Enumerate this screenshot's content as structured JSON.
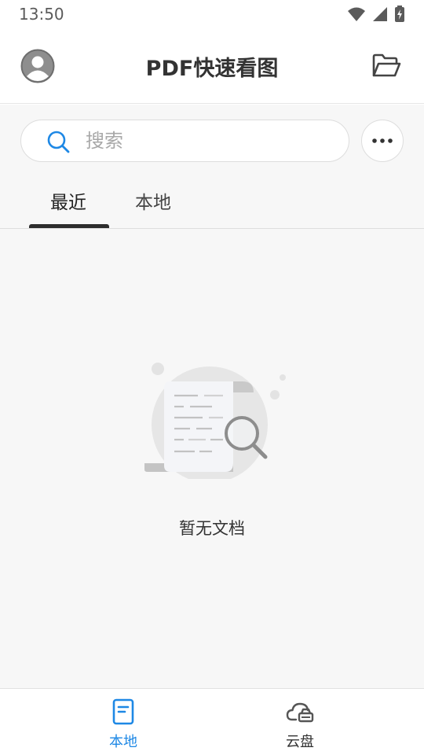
{
  "status_bar": {
    "time": "13:50",
    "icons": [
      "wifi-icon",
      "signal-icon",
      "battery-charging-icon"
    ]
  },
  "header": {
    "title": "PDF快速看图",
    "left_icon": "avatar-icon",
    "right_icon": "folder-open-icon"
  },
  "search": {
    "placeholder": "搜索",
    "value": "",
    "icon": "search-icon",
    "more_icon": "more-dots-icon"
  },
  "tabs": [
    {
      "label": "最近",
      "active": true
    },
    {
      "label": "本地",
      "active": false
    }
  ],
  "empty_state": {
    "icon": "empty-document-search-icon",
    "text": "暂无文档"
  },
  "bottom_nav": [
    {
      "label": "本地",
      "icon": "local-file-icon",
      "active": true
    },
    {
      "label": "云盘",
      "icon": "cloud-drive-icon",
      "active": false
    }
  ],
  "colors": {
    "accent": "#1e88e5",
    "text_primary": "#333333",
    "background": "#f7f7f7"
  }
}
